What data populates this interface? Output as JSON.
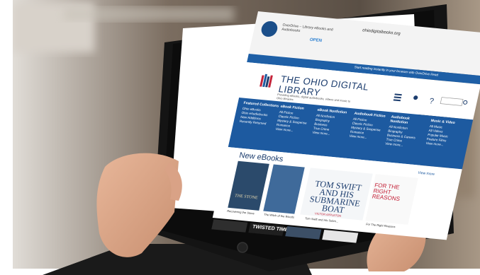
{
  "browser": {
    "url": "ohiodigitalbooks.org",
    "app_name": "OverDrive – Library eBooks and Audiobooks",
    "open_label": "OPEN",
    "promo": "Start reading instantly in your browser with OverDrive Read"
  },
  "site": {
    "title_line1": "THE OHIO DIGITAL",
    "title_line2": "LIBRARY",
    "subtitle": "Providing eBooks, digital audiobooks, videos and music to Ohio libraries",
    "menu_labels": [
      "Menu",
      "Account",
      "Help",
      "Search"
    ]
  },
  "nav": [
    {
      "heading": "Featured Collections",
      "items": [
        "Ohio eBooks",
        "Ohio eAudiobooks",
        "New Additions",
        "Recently Returned"
      ]
    },
    {
      "heading": "eBook Fiction",
      "items": [
        "All Fiction",
        "Classic Fiction",
        "Mystery & Suspense",
        "Romance",
        "View more..."
      ]
    },
    {
      "heading": "eBook Nonfiction",
      "items": [
        "All Nonfiction",
        "Biography",
        "Business",
        "True Crime",
        "View more..."
      ]
    },
    {
      "heading": "Audiobook Fiction",
      "items": [
        "All Fiction",
        "Classic Fiction",
        "Mystery & Suspense",
        "Romance",
        "View more..."
      ]
    },
    {
      "heading": "Audiobook Nonfiction",
      "items": [
        "All Nonfiction",
        "Biography",
        "Business & Careers",
        "True Crime",
        "View more..."
      ]
    },
    {
      "heading": "Music & Video",
      "items": [
        "All Music",
        "All Videos",
        "Popular Music",
        "Feature Films",
        "View more..."
      ]
    }
  ],
  "section": {
    "title": "New eBooks",
    "view_more": "View more",
    "books": [
      {
        "cover_text": "THE STONE",
        "caption": "Recovering the Stone"
      },
      {
        "cover_text": "",
        "caption": "The Witch of the Woods"
      },
      {
        "cover_text": "TOM SWIFT AND HIS SUBMARINE BOAT",
        "caption": "Tom Swift and His Subm..."
      },
      {
        "cover_text": "FOR THE RIGHT REASONS",
        "caption": "For The Right Reasons"
      }
    ],
    "tom_swift_author": "VICTOR APPLETON",
    "row2_title": "TWISTED TIMBER"
  },
  "colors": {
    "nav_blue": "#1d5aa0",
    "title_navy": "#1c3d6e",
    "tablet_black": "#111111",
    "background_blur": "#6b5e52"
  }
}
